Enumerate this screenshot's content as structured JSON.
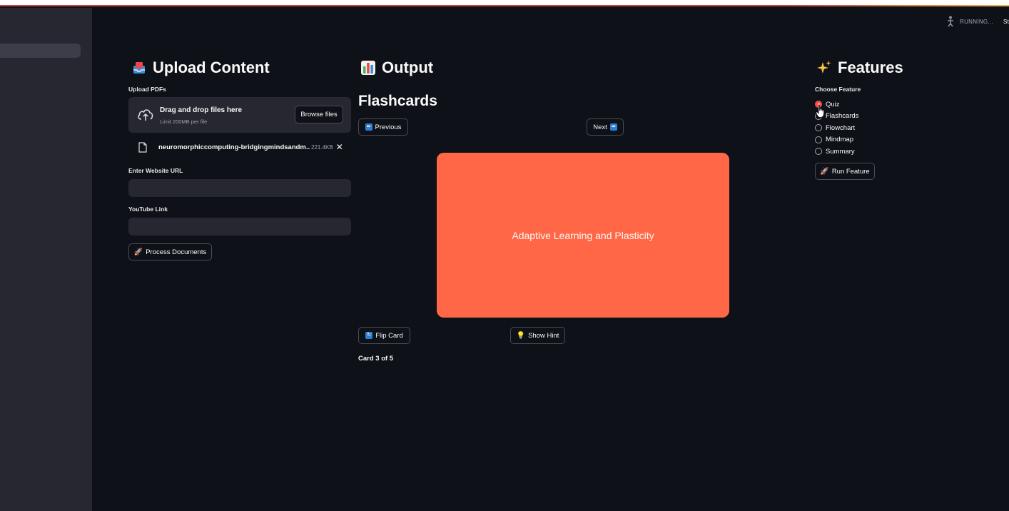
{
  "status": {
    "running": "RUNNING...",
    "stop": "Sto"
  },
  "upload": {
    "heading": "Upload Content",
    "pdf_label": "Upload PDFs",
    "dropzone_title": "Drag and drop files here",
    "dropzone_limit": "Limit 200MB per file",
    "browse_label": "Browse files",
    "file_name": "neuromorphiccomputing-bridgingmindsandm...",
    "file_size": "221.4KB",
    "url_label": "Enter Website URL",
    "url_value": "",
    "youtube_label": "YouTube Link",
    "youtube_value": "",
    "process_label": "Process Documents"
  },
  "output": {
    "heading": "Output",
    "subheading": "Flashcards",
    "previous_label": "Previous",
    "next_label": "Next",
    "card_text": "Adaptive Learning and Plasticity",
    "flip_label": "Flip Card",
    "hint_label": "Show Hint",
    "card_counter": "Card 3 of 5"
  },
  "features": {
    "heading": "Features",
    "choose_label": "Choose Feature",
    "options": [
      "Quiz",
      "Flashcards",
      "Flowchart",
      "Mindmap",
      "Summary"
    ],
    "selected": "Quiz",
    "run_label": "Run Feature"
  },
  "colors": {
    "background": "#0e1117",
    "sidebar": "#262730",
    "card": "#ff6747",
    "accent": "#ff4b4b"
  },
  "icons": {
    "upload_heading": "inbox-tray-icon",
    "output_heading": "bar-chart-icon",
    "features_heading": "sparkles-icon",
    "dropzone": "cloud-upload-icon",
    "file": "document-icon",
    "process": "rocket-icon",
    "run": "rocket-icon",
    "previous": "left-arrow-icon",
    "next": "right-arrow-icon",
    "flip": "refresh-icon",
    "hint": "lightbulb-icon"
  }
}
